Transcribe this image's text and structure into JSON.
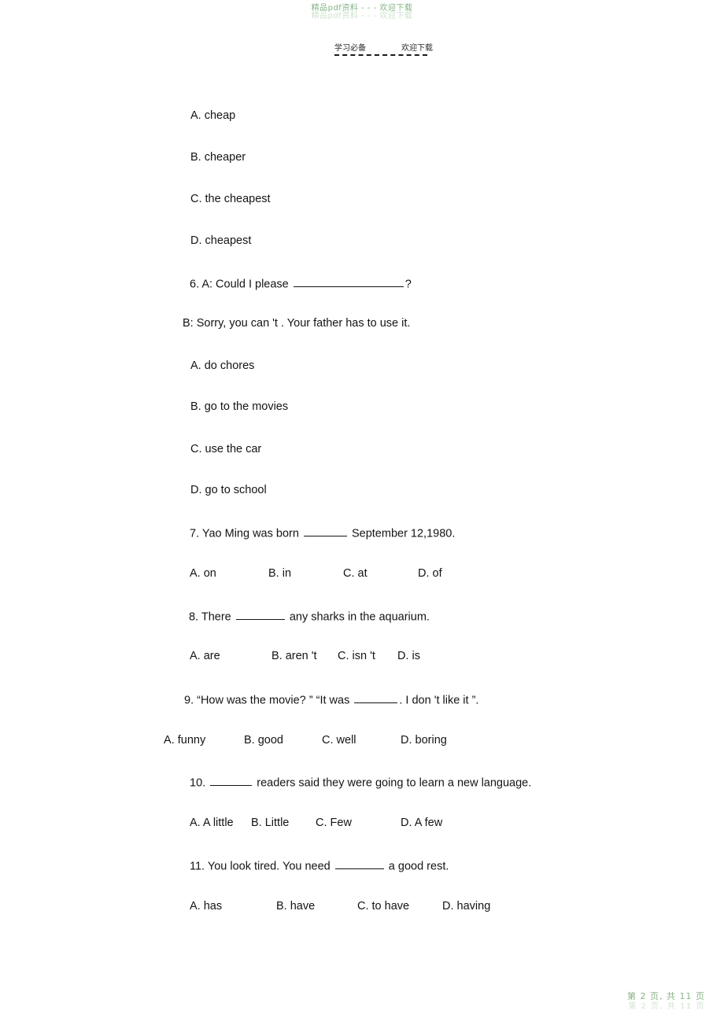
{
  "watermark": {
    "top": "精品pdf资料 - - - 欢迎下载",
    "bottom": "第 2 页, 共 11 页"
  },
  "header": {
    "left": "学习必备",
    "right": "欢迎下载"
  },
  "content": {
    "q5_options": [
      {
        "text": "A. cheap"
      },
      {
        "text": "B. cheaper"
      },
      {
        "text": "C. the cheapest"
      },
      {
        "text": "D. cheapest"
      }
    ],
    "q6": {
      "stem_pre": "6. A: Could I please",
      "stem_post": "?",
      "reply": "B: Sorry, you can  't . Your father has to use it.",
      "options": [
        {
          "text": "A. do chores"
        },
        {
          "text": "B. go to the movies"
        },
        {
          "text": "C. use the car"
        },
        {
          "text": "D. go to school"
        }
      ]
    },
    "q7": {
      "stem_pre": "7. Yao Ming was born",
      "stem_post": "September 12,1980.",
      "options": [
        "A. on",
        "B. in",
        "C. at",
        "D. of"
      ]
    },
    "q8": {
      "stem_pre": "8. There",
      "stem_post": "any sharks in the aquarium.",
      "options": [
        "A. are",
        "B. aren 't",
        "C. isn 't",
        "D. is"
      ]
    },
    "q9": {
      "stem_pre": "9.   “How was the movie?   ”      “It was",
      "stem_post": ". I don    't like it  ”.",
      "options": [
        "A. funny",
        "B. good",
        "C. well",
        "D. boring"
      ]
    },
    "q10": {
      "stem_pre": "10.",
      "stem_post": "readers said they were going to learn a new language.",
      "options": [
        "A. A little",
        "B. Little",
        "C. Few",
        "D. A few"
      ]
    },
    "q11": {
      "stem_pre": "11. You look tired. You need",
      "stem_post": "a good rest.",
      "options": [
        "A. has",
        "B. have",
        "C. to have",
        "D. having"
      ]
    }
  }
}
